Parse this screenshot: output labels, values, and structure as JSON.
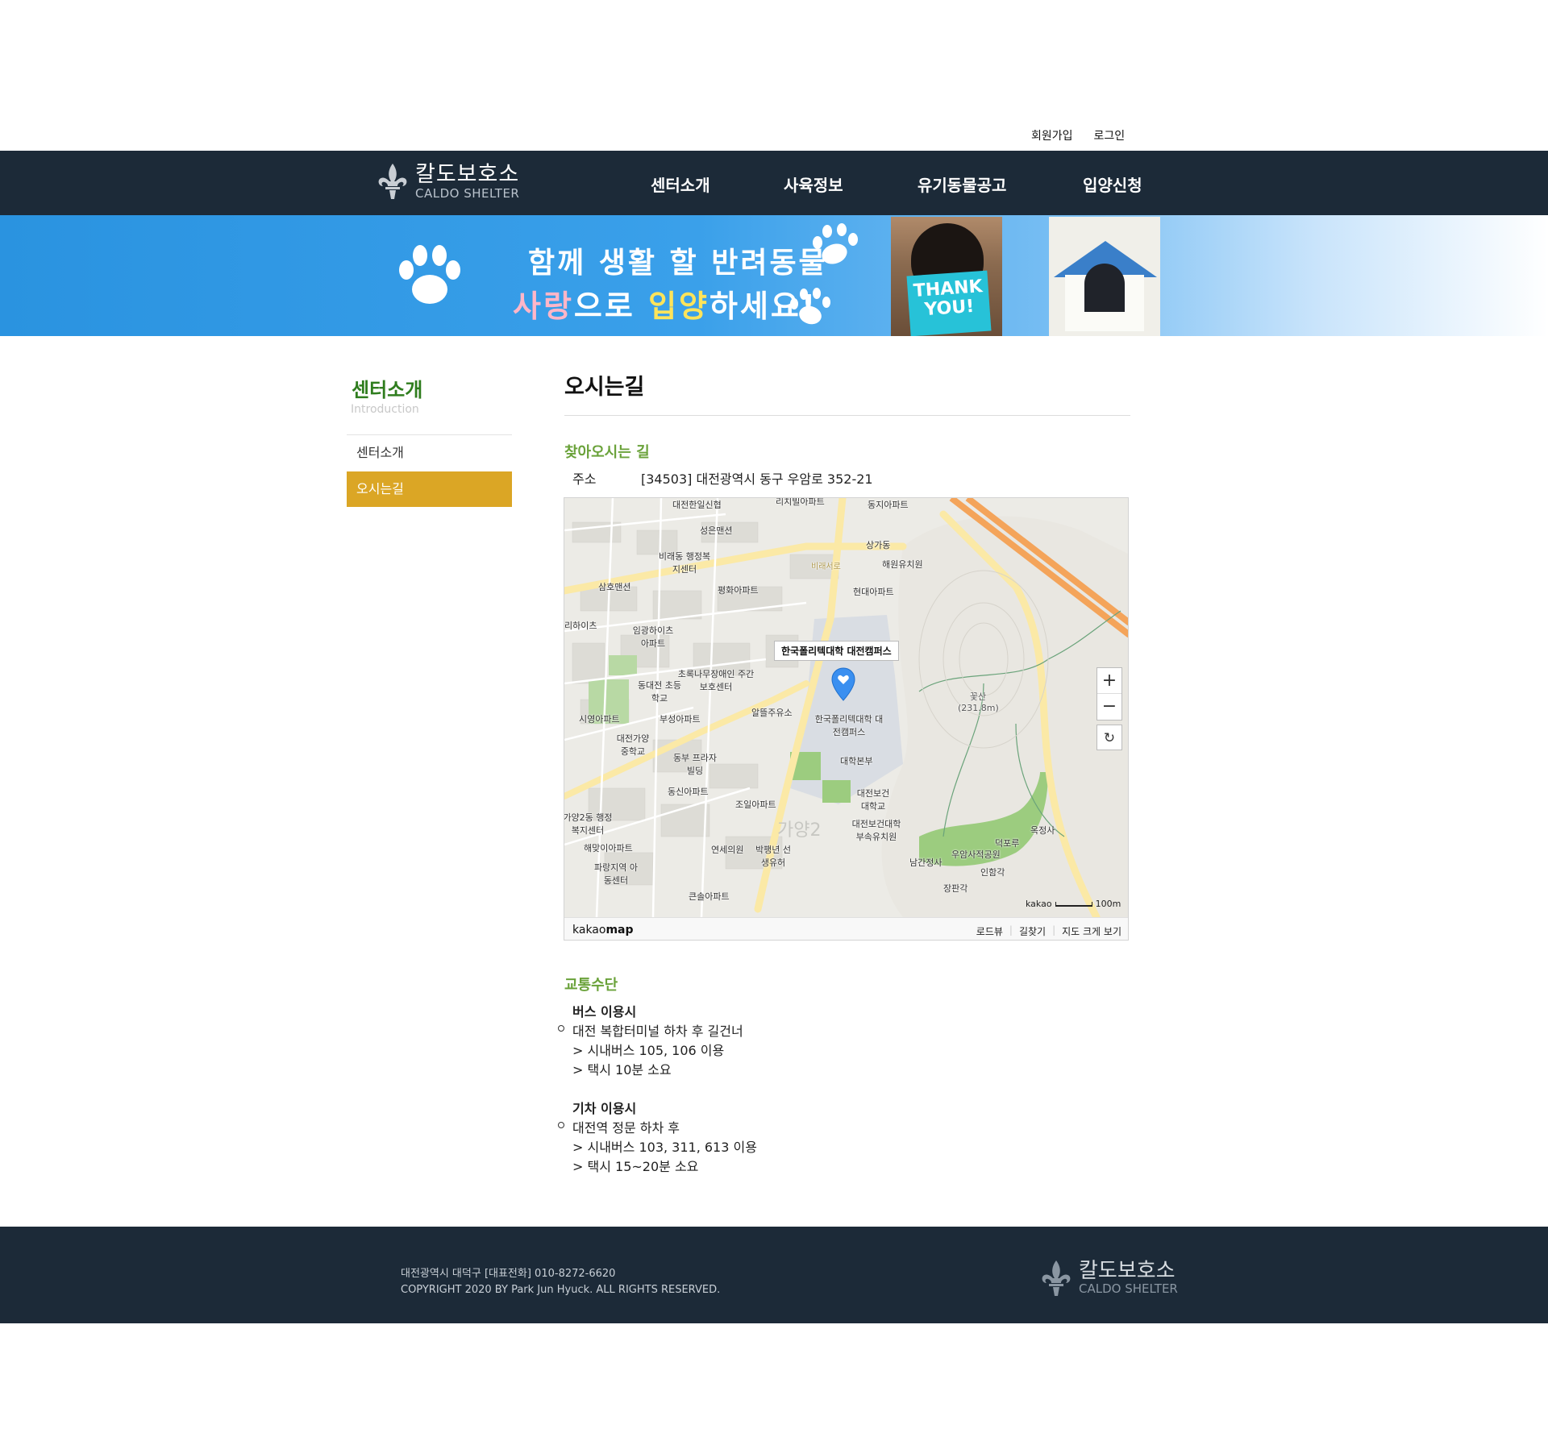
{
  "util_links": {
    "signup": "회원가입",
    "login": "로그인"
  },
  "header": {
    "logo_ko": "칼도보호소",
    "logo_en": "CALDO SHELTER",
    "nav": [
      "센터소개",
      "사육정보",
      "유기동물공고",
      "입양신청"
    ]
  },
  "banner": {
    "line1": "함께 생활 할 반려동물",
    "line2_parts": [
      "사랑",
      "으로 ",
      "입양",
      "하세요!"
    ],
    "card_text": "THANK YOU!"
  },
  "sidebar": {
    "title": "센터소개",
    "subtitle": "Introduction",
    "items": [
      "센터소개",
      "오시는길"
    ],
    "active_color": "#dba625"
  },
  "main": {
    "title": "오시는길",
    "directions_title": "찾아오시는 길",
    "address_label": "주소",
    "address_value": "[34503] 대전광역시 동구 우암로 352-21",
    "transport_title": "교통수단"
  },
  "map": {
    "popup": "한국폴리텍대학 대전캠퍼스",
    "scale_brand": "kakao",
    "scale_value": "100m",
    "footer_brand_light": "kakao",
    "footer_brand_bold": "map",
    "footer_links": [
      "로드뷰",
      "길찾기",
      "지도 크게 보기"
    ],
    "labels": {
      "l1": "대전한일신협",
      "l2": "리치빌아파트",
      "l3": "동지아파트",
      "l4": "성은맨션",
      "l5": "비래동 행정복지센터",
      "l6": "상가동",
      "l7": "해원유치원",
      "l8": "비래서로",
      "l9": "삼호맨션",
      "l10": "평화아파트",
      "l11": "현대아파트",
      "l12": "임광하이츠 아파트",
      "l13": "동대전 초등학교",
      "l14": "초록나무장애인 주간보호센터",
      "l15": "알뜰주유소",
      "l16": "한국폴리텍대학 대전캠퍼스",
      "l17": "부성아파트",
      "l18": "대전가양 중학교",
      "l19": "동부 프라자빌딩",
      "l20": "대학본부",
      "l21": "동신아파트",
      "l22": "대전보건 대학교",
      "l23": "조일아파트",
      "l24": "가양2동 행정복지센터",
      "l25": "대전보건대학 부속유치원",
      "l26": "해맞이아파트",
      "l27": "연세의원",
      "l28": "박팽년 선생유허",
      "l29": "파랑지역 아동센터",
      "l30": "우암사적공원",
      "l31": "남간정사",
      "l32": "인함각",
      "l33": "덕포루",
      "l34": "옥정사",
      "l35": "장판각",
      "l36": "꽃산 (231.8m)",
      "l37": "큰솔아파트",
      "l38": "시영아파트",
      "l39": "가양2",
      "l40": "리하이츠"
    }
  },
  "transport": {
    "bus_head": "버스 이용시",
    "bus_lines": [
      "대전 복합터미널 하차 후 길건너",
      "> 시내버스 105, 106 이용",
      "> 택시 10분 소요"
    ],
    "train_head": "기차 이용시",
    "train_lines": [
      "대전역 정문 하차 후",
      "> 시내버스 103, 311, 613 이용",
      "> 택시 15~20분 소요"
    ]
  },
  "footer": {
    "address": "대전광역시 대덕구 [대표전화] 010-8272-6620",
    "copyright": "COPYRIGHT 2020 BY Park Jun Hyuck. ALL RIGHTS RESERVED.",
    "logo_ko": "칼도보호소",
    "logo_en": "CALDO SHELTER"
  },
  "colors": {
    "header_bg": "#1c2a38",
    "accent_green": "#6aa23a",
    "sidebar_title": "#2f7d1e",
    "map_pin": "#3a8ff0"
  }
}
